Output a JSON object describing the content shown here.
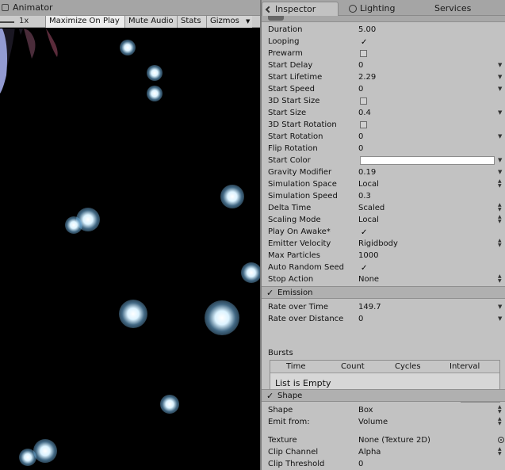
{
  "left_panel": {
    "tab_title": "Animator",
    "scale_label": "1x",
    "toolbar": {
      "maximize_on_play": "Maximize On Play",
      "mute_audio": "Mute Audio",
      "stats": "Stats",
      "gizmos": "Gizmos"
    }
  },
  "right_panel": {
    "tabs": {
      "inspector": "Inspector",
      "lighting": "Lighting",
      "services": "Services"
    },
    "main_module": [
      {
        "label": "Duration",
        "value": "5.00"
      },
      {
        "label": "Looping",
        "checked": true
      },
      {
        "label": "Prewarm",
        "checked": false
      },
      {
        "label": "Start Delay",
        "value": "0",
        "dropdown": true
      },
      {
        "label": "Start Lifetime",
        "value": "2.29",
        "dropdown": true
      },
      {
        "label": "Start Speed",
        "value": "0",
        "dropdown": true
      },
      {
        "label": "3D Start Size",
        "checked": false
      },
      {
        "label": "Start Size",
        "value": "0.4",
        "dropdown": true
      },
      {
        "label": "3D Start Rotation",
        "checked": false
      },
      {
        "label": "Start Rotation",
        "value": "0",
        "dropdown": true
      },
      {
        "label": "Flip Rotation",
        "value": "0"
      },
      {
        "label": "Start Color",
        "color": "#ffffff",
        "dropdown": true
      },
      {
        "label": "Gravity Modifier",
        "value": "0.19",
        "dropdown": true
      },
      {
        "label": "Simulation Space",
        "value": "Local",
        "select": true
      },
      {
        "label": "Simulation Speed",
        "value": "0.3"
      },
      {
        "label": "Delta Time",
        "value": "Scaled",
        "select": true
      },
      {
        "label": "Scaling Mode",
        "value": "Local",
        "select": true
      },
      {
        "label": "Play On Awake*",
        "checked": true
      },
      {
        "label": "Emitter Velocity",
        "value": "Rigidbody",
        "select": true
      },
      {
        "label": "Max Particles",
        "value": "1000"
      },
      {
        "label": "Auto Random Seed",
        "checked": true
      },
      {
        "label": "Stop Action",
        "value": "None",
        "select": true
      }
    ],
    "emission": {
      "title": "Emission",
      "rate_over_time_label": "Rate over Time",
      "rate_over_time_value": "149.7",
      "rate_over_distance_label": "Rate over Distance",
      "rate_over_distance_value": "0",
      "bursts_label": "Bursts",
      "bursts_columns": [
        "Time",
        "Count",
        "Cycles",
        "Interval"
      ],
      "bursts_empty": "List is Empty",
      "add": "+",
      "remove": "−"
    },
    "shape": {
      "title": "Shape",
      "shape_label": "Shape",
      "shape_value": "Box",
      "emit_from_label": "Emit from:",
      "emit_from_value": "Volume",
      "texture_label": "Texture",
      "texture_value": "None (Texture 2D)",
      "clip_channel_label": "Clip Channel",
      "clip_channel_value": "Alpha",
      "clip_threshold_label": "Clip Threshold",
      "clip_threshold_value": "0"
    }
  }
}
